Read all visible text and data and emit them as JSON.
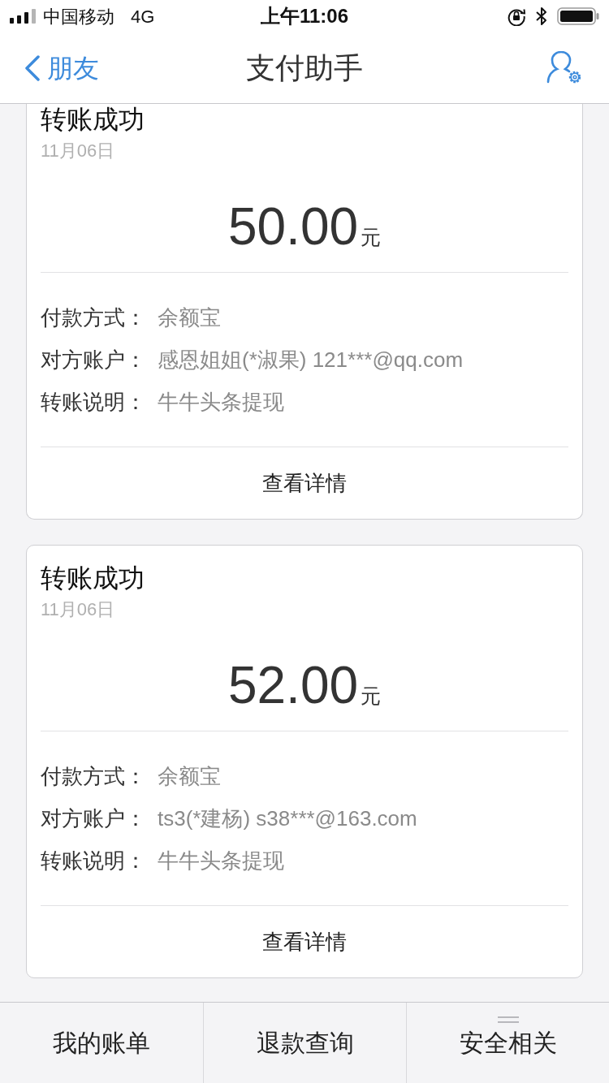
{
  "status_bar": {
    "carrier": "中国移动",
    "network": "4G",
    "time": "上午11:06"
  },
  "nav": {
    "back_label": "朋友",
    "title": "支付助手"
  },
  "cards": [
    {
      "title": "转账成功",
      "date": "11月06日",
      "amount": "50.00",
      "unit": "元",
      "fields": [
        {
          "label": "付款方式：",
          "value": "余额宝"
        },
        {
          "label": "对方账户：",
          "value": "感恩姐姐(*淑果) 121***@qq.com"
        },
        {
          "label": "转账说明：",
          "value": "牛牛头条提现"
        }
      ],
      "action": "查看详情"
    },
    {
      "title": "转账成功",
      "date": "11月06日",
      "amount": "52.00",
      "unit": "元",
      "fields": [
        {
          "label": "付款方式：",
          "value": "余额宝"
        },
        {
          "label": "对方账户：",
          "value": "ts3(*建杨) s38***@163.com"
        },
        {
          "label": "转账说明：",
          "value": "牛牛头条提现"
        }
      ],
      "action": "查看详情"
    }
  ],
  "tab_bar": [
    {
      "label": "我的账单",
      "has_submenu": false
    },
    {
      "label": "退款查询",
      "has_submenu": false
    },
    {
      "label": "安全相关",
      "has_submenu": true
    }
  ]
}
